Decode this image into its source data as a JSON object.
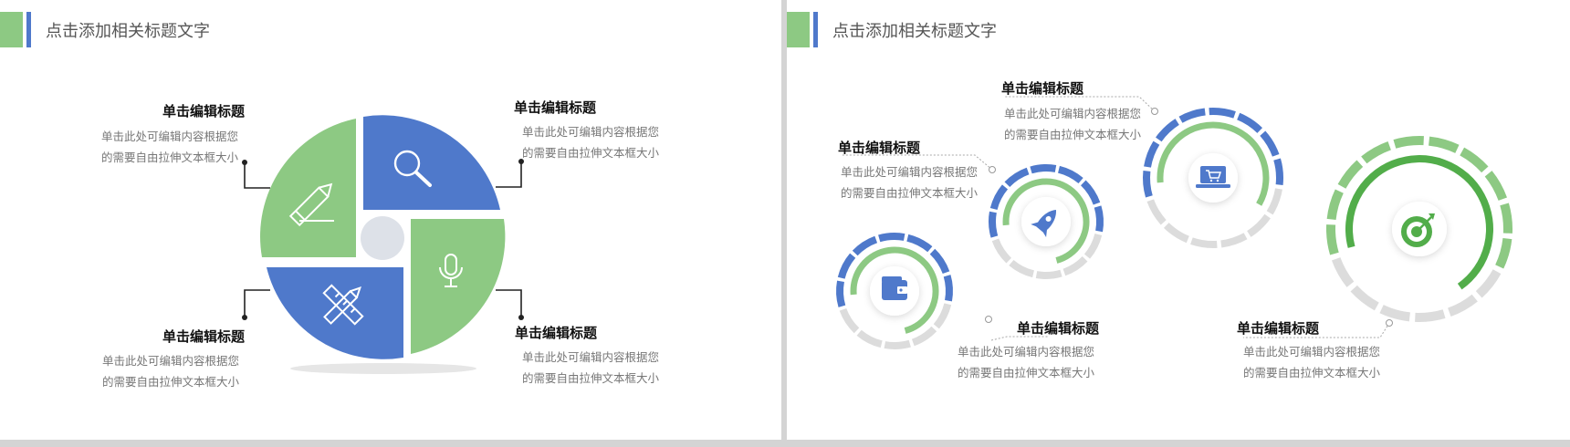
{
  "slides": [
    {
      "header_title": "点击添加相关标题文字",
      "items": [
        {
          "title": "单击编辑标题",
          "line1": "单击此处可编辑内容根据您",
          "line2": "的需要自由拉伸文本框大小"
        },
        {
          "title": "单击编辑标题",
          "line1": "单击此处可编辑内容根据您",
          "line2": "的需要自由拉伸文本框大小"
        },
        {
          "title": "单击编辑标题",
          "line1": "单击此处可编辑内容根据您",
          "line2": "的需要自由拉伸文本框大小"
        },
        {
          "title": "单击编辑标题",
          "line1": "单击此处可编辑内容根据您",
          "line2": "的需要自由拉伸文本框大小"
        }
      ],
      "icons": [
        "pencil-icon",
        "search-icon",
        "ruler-pencil-icon",
        "microphone-icon"
      ]
    },
    {
      "header_title": "点击添加相关标题文字",
      "items": [
        {
          "title": "单击编辑标题",
          "line1": "单击此处可编辑内容根据您",
          "line2": "的需要自由拉伸文本框大小"
        },
        {
          "title": "单击编辑标题",
          "line1": "单击此处可编辑内容根据您",
          "line2": "的需要自由拉伸文本框大小"
        },
        {
          "title": "单击编辑标题",
          "line1": "单击此处可编辑内容根据您",
          "line2": "的需要自由拉伸文本框大小"
        },
        {
          "title": "单击编辑标题",
          "line1": "单击此处可编辑内容根据您",
          "line2": "的需要自由拉伸文本框大小"
        }
      ],
      "icons": [
        "wallet-icon",
        "rocket-icon",
        "laptop-cart-icon",
        "target-icon"
      ]
    }
  ],
  "colors": {
    "green": "#8dc983",
    "dark_green": "#52ad4a",
    "blue": "#4f79cb",
    "gray": "#dcdcdc",
    "title_text": "#555555",
    "body_text": "#777777"
  }
}
